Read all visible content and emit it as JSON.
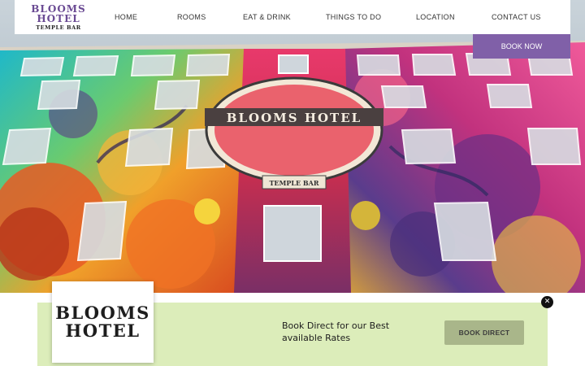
{
  "header": {
    "logo": {
      "line1": "BLOOMS",
      "line2": "HOTEL",
      "line3": "TEMPLE BAR"
    },
    "nav": [
      {
        "label": "HOME"
      },
      {
        "label": "ROOMS"
      },
      {
        "label": "EAT & DRINK"
      },
      {
        "label": "THINGS TO DO"
      },
      {
        "label": "LOCATION"
      },
      {
        "label": "CONTACT US"
      }
    ],
    "book_now": "BOOK NOW"
  },
  "hero": {
    "sign_text": "BLOOMS HOTEL",
    "plaque_text": "TEMPLE BAR"
  },
  "banner": {
    "logo": {
      "line1": "BLOOMS",
      "line2": "HOTEL"
    },
    "text": "Book Direct for our Best available Rates",
    "button": "BOOK DIRECT",
    "close": "✕"
  },
  "colors": {
    "brand_purple": "#8060a8",
    "logo_purple": "#6a4a93",
    "banner_green": "#dcedba",
    "button_olive": "#a9b68a"
  }
}
